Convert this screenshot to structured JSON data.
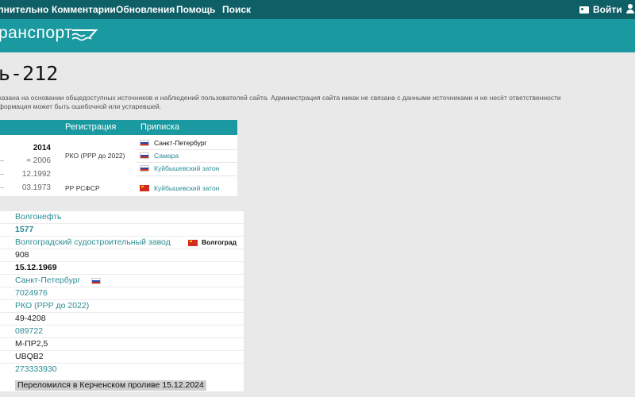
{
  "nav": {
    "items": [
      "лнительно",
      "Комментарии",
      "Обновления",
      "Помощь",
      "Поиск"
    ],
    "login_label": "Войти"
  },
  "banner": {
    "logo_text": "ранспорт"
  },
  "page": {
    "title": "ь-212",
    "disclaimer_line1": "казана на основании общедоступных источников и наблюдений пользователей сайта. Администрация сайта никак не связана с данными источниками и не несёт ответственности",
    "disclaimer_line2": "формация может быть ошибочной или устаревшей."
  },
  "registry": {
    "headers": {
      "registration": "Регистрация",
      "port": "Приписка"
    },
    "years": [
      "2014",
      "≈ 2006",
      "12.1992",
      "03.1973"
    ],
    "registrations": [
      "РКО (РРР до 2022)",
      "РР РСФСР"
    ],
    "ports": [
      "Санкт-Петербург",
      "Самара",
      "Куйбышевский затон",
      "Куйбышевский затон"
    ]
  },
  "details": {
    "owner": "Волгонефть",
    "project": "1577",
    "builder": "Волгоградский судостроительный завод",
    "builder_city": "Волгоград",
    "build_number": "908",
    "build_date": "15.12.1969",
    "home_port": "Санкт-Петербург",
    "imo": "7024976",
    "registry_class": "РКО (РРР до 2022)",
    "reg_number": "49-4208",
    "reg_book": "089722",
    "class_formula": "М-ПР2,5",
    "call_sign": "UBQB2",
    "mmsi": "273333930",
    "fate": "Переломился в Керченском проливе 15.12.2024"
  }
}
